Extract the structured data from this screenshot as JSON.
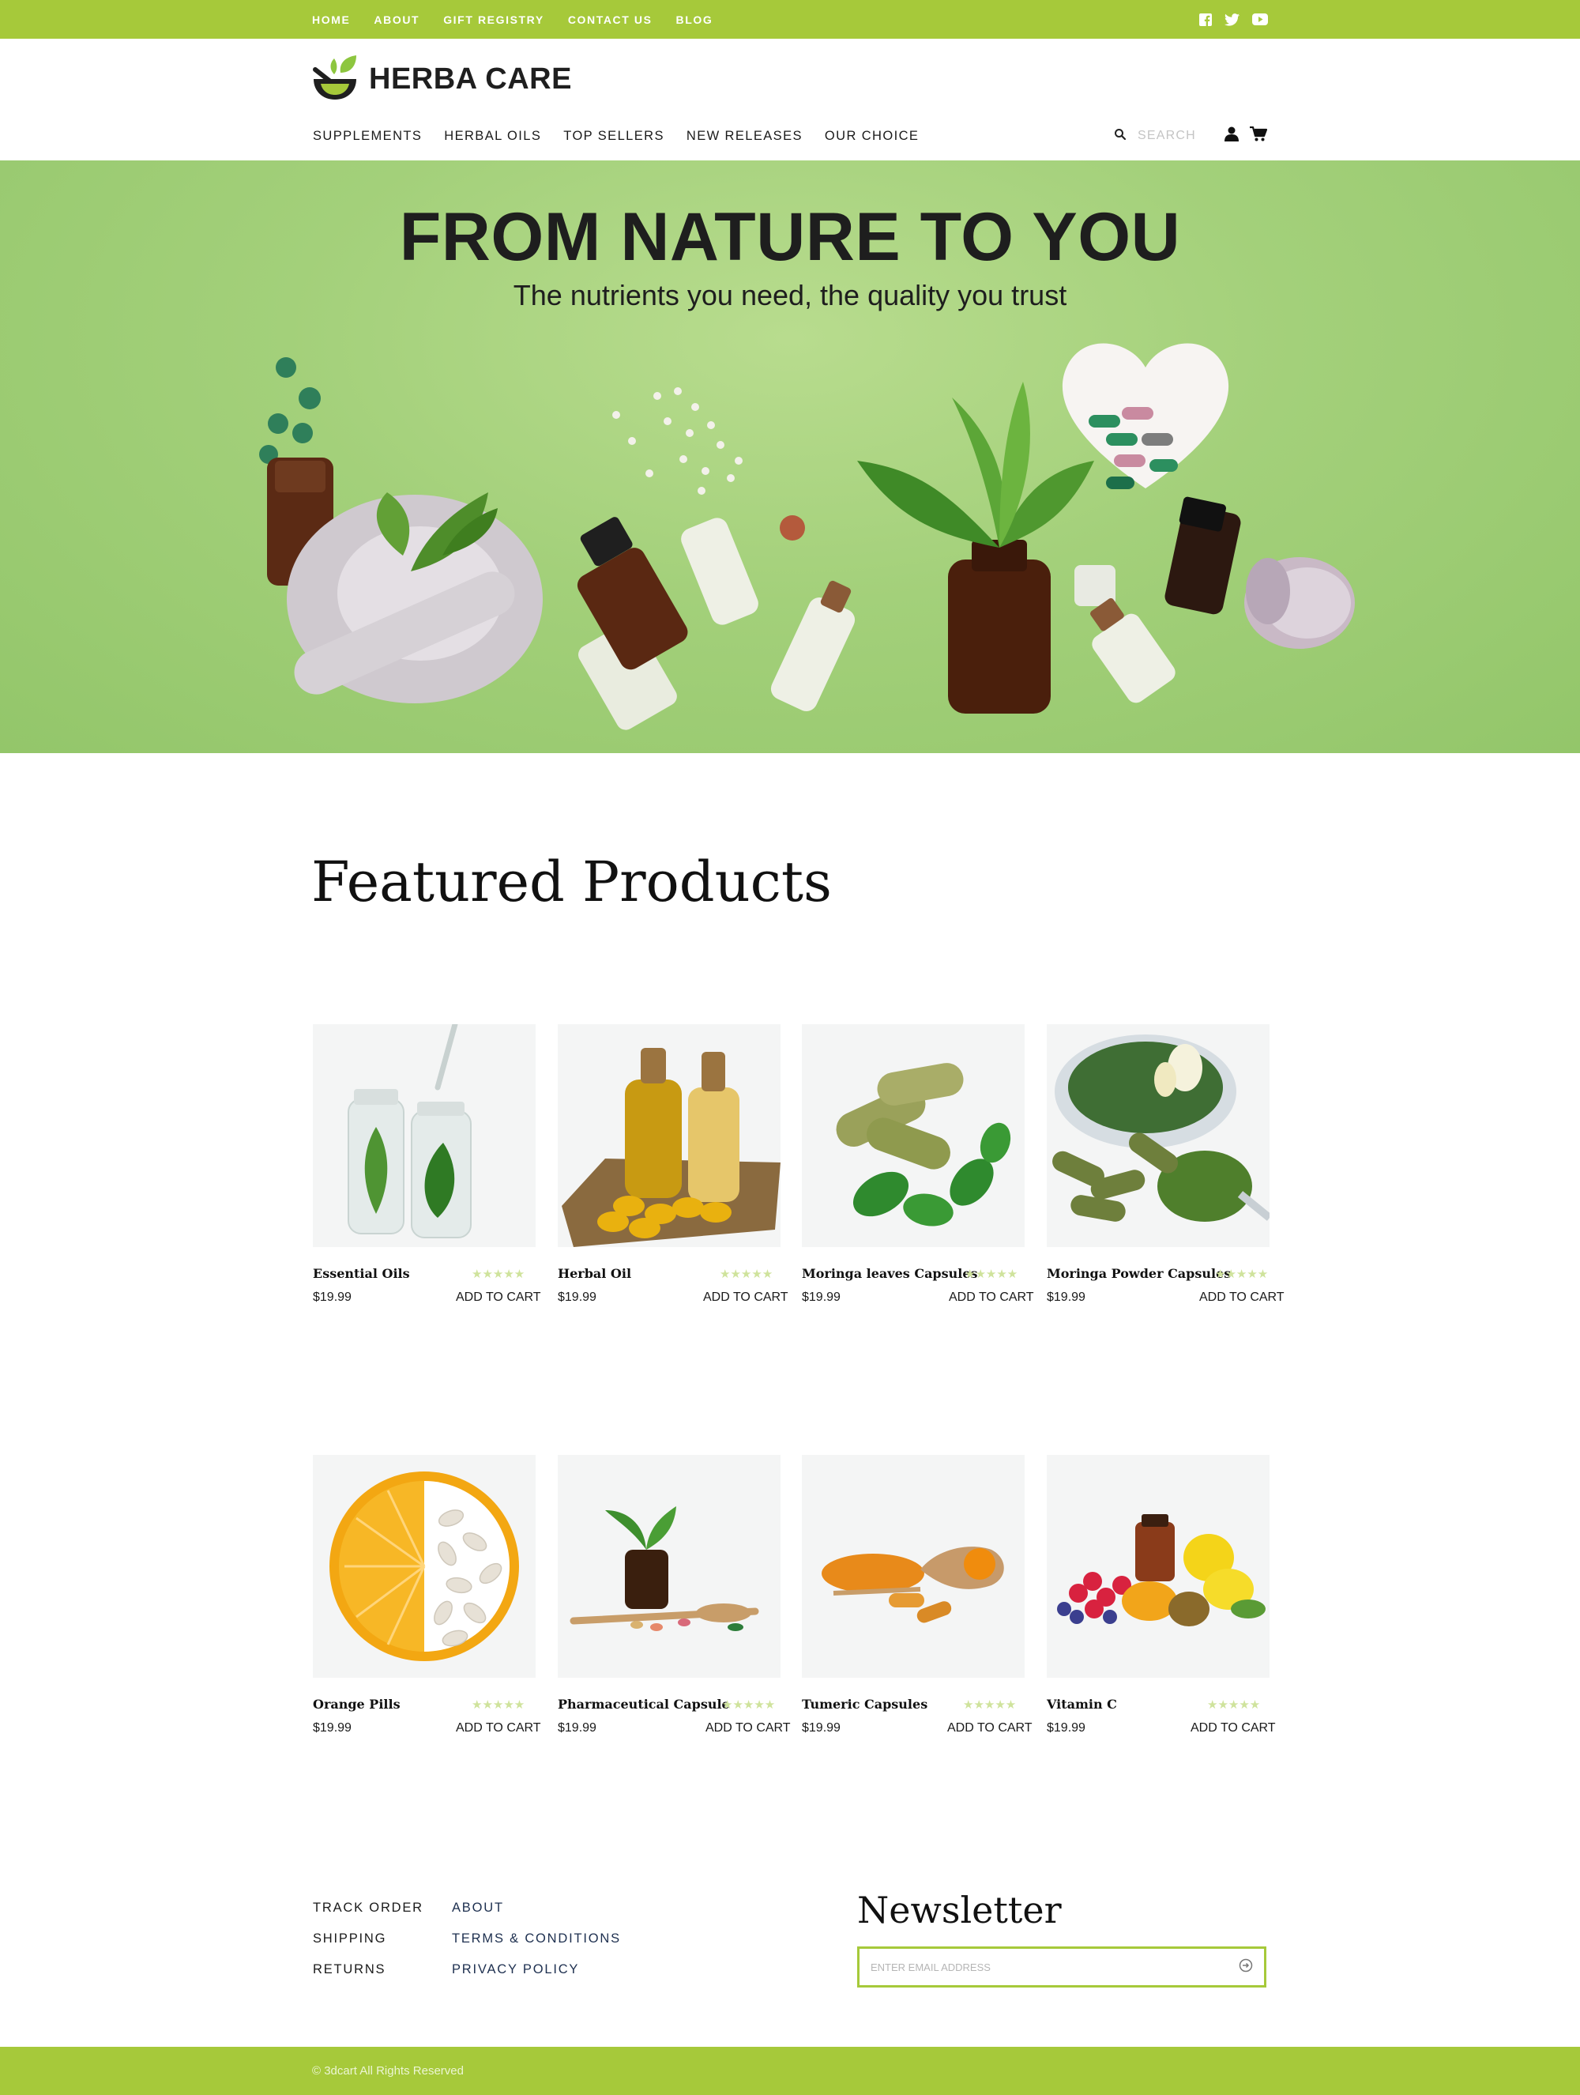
{
  "topbar": {
    "links": [
      "HOME",
      "ABOUT",
      "GIFT REGISTRY",
      "CONTACT US",
      "BLOG"
    ],
    "social_icons": [
      "facebook-icon",
      "twitter-icon",
      "youtube-icon"
    ]
  },
  "header": {
    "logo_text": "HERBA CARE",
    "nav": [
      "SUPPLEMENTS",
      "HERBAL OILS",
      "TOP SELLERS",
      "NEW RELEASES",
      "OUR CHOICE"
    ],
    "search_placeholder": "SEARCH",
    "icons": [
      "search-icon",
      "user-icon",
      "cart-icon"
    ]
  },
  "hero": {
    "title": "FROM NATURE TO YOU",
    "subtitle": "The nutrients you need, the quality you trust"
  },
  "featured": {
    "title": "Featured Products",
    "products": [
      {
        "name": "Essential Oils",
        "price": "$19.99",
        "cart": "ADD TO CART",
        "rating": 5,
        "stars": "★★★★★"
      },
      {
        "name": "Herbal Oil",
        "price": "$19.99",
        "cart": "ADD TO CART",
        "rating": 5,
        "stars": "★★★★★"
      },
      {
        "name": "Moringa leaves Capsules",
        "price": "$19.99",
        "cart": "ADD TO CART",
        "rating": 5,
        "stars": "★★★★★"
      },
      {
        "name": "Moringa Powder Capsules",
        "price": "$19.99",
        "cart": "ADD TO CART",
        "rating": 5,
        "stars": "★★★★★"
      },
      {
        "name": "Orange Pills",
        "price": "$19.99",
        "cart": "ADD TO CART",
        "rating": 5,
        "stars": "★★★★★"
      },
      {
        "name": "Pharmaceutical Capsule",
        "price": "$19.99",
        "cart": "ADD TO CART",
        "rating": 5,
        "stars": "★★★★★"
      },
      {
        "name": "Tumeric Capsules",
        "price": "$19.99",
        "cart": "ADD TO CART",
        "rating": 5,
        "stars": "★★★★★"
      },
      {
        "name": "Vitamin C",
        "price": "$19.99",
        "cart": "ADD TO CART",
        "rating": 5,
        "stars": "★★★★★"
      }
    ]
  },
  "footer": {
    "links_left": [
      "TRACK ORDER",
      "SHIPPING",
      "RETURNS"
    ],
    "links_right": [
      "ABOUT",
      "TERMS & CONDITIONS",
      "PRIVACY POLICY"
    ],
    "newsletter_title": "Newsletter",
    "email_placeholder": "ENTER EMAIL ADDRESS",
    "copyright": "© 3dcart All Rights Reserved"
  },
  "colors": {
    "accent": "#a6c93a",
    "hero_bg": "#a3d07a",
    "star": "#cfe39c"
  }
}
